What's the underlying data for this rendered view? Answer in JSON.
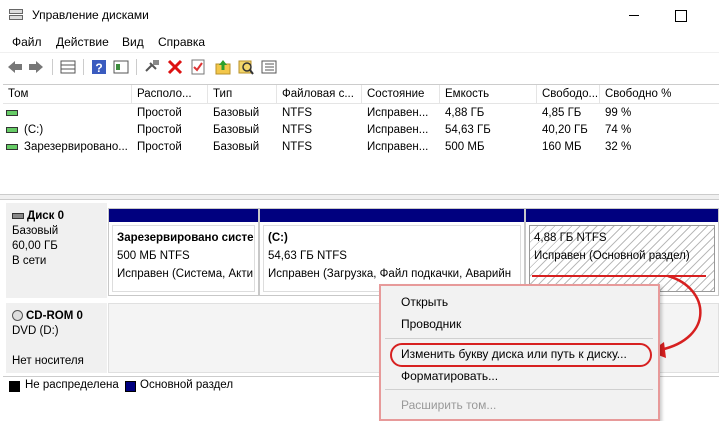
{
  "window": {
    "title": "Управление дисками"
  },
  "menu": [
    "Файл",
    "Действие",
    "Вид",
    "Справка"
  ],
  "toolbar": {
    "icons": [
      "back-arrow-icon",
      "forward-arrow-icon",
      "list-view-icon",
      "help-icon",
      "properties-icon",
      "connect-icon",
      "delete-icon",
      "check-icon",
      "folder-up-icon",
      "search-icon",
      "details-icon"
    ]
  },
  "volume_list": {
    "columns": [
      "Том",
      "Располо...",
      "Тип",
      "Файловая с...",
      "Состояние",
      "Емкость",
      "Свободо...",
      "Свободно %"
    ],
    "rows": [
      {
        "tom": "",
        "rasp": "Простой",
        "tip": "Базовый",
        "fs": "NTFS",
        "state": "Исправен...",
        "cap": "4,88 ГБ",
        "free": "4,85 ГБ",
        "pct": "99 %"
      },
      {
        "tom": "(C:)",
        "rasp": "Простой",
        "tip": "Базовый",
        "fs": "NTFS",
        "state": "Исправен...",
        "cap": "54,63 ГБ",
        "free": "40,20 ГБ",
        "pct": "74 %"
      },
      {
        "tom": "Зарезервировано...",
        "rasp": "Простой",
        "tip": "Базовый",
        "fs": "NTFS",
        "state": "Исправен...",
        "cap": "500 МБ",
        "free": "160 МБ",
        "pct": "32 %"
      }
    ]
  },
  "disk0": {
    "name": "Диск 0",
    "type": "Базовый",
    "size": "60,00 ГБ",
    "status": "В сети",
    "partitions": [
      {
        "name": "Зарезервировано систе",
        "size": "500 МБ NTFS",
        "status": "Исправен (Система, Акти"
      },
      {
        "name": "(C:)",
        "size": "54,63 ГБ NTFS",
        "status": "Исправен (Загрузка, Файл подкачки, Аварийн"
      },
      {
        "name": "",
        "size": "4,88 ГБ NTFS",
        "status": "Исправен (Основной раздел)"
      }
    ]
  },
  "cdrom": {
    "name": "CD-ROM 0",
    "type": "DVD (D:)",
    "status": "Нет носителя"
  },
  "legend": {
    "unallocated": "Не распределена",
    "primary": "Основной раздел",
    "colors": {
      "unallocated": "#000000",
      "primary": "#00007f"
    }
  },
  "context_menu": {
    "items": [
      "Открыть",
      "Проводник",
      "Изменить букву диска или путь к диску...",
      "Форматировать...",
      "Расширить том..."
    ]
  }
}
